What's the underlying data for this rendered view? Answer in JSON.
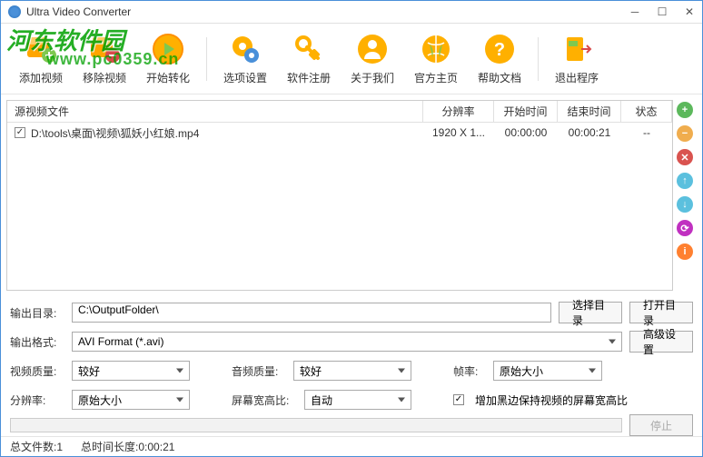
{
  "titlebar": {
    "title": "Ultra Video Converter"
  },
  "watermark": {
    "text": "河东软件园",
    "url": "www.pc0359.cn"
  },
  "toolbar": {
    "add": "添加视频",
    "remove": "移除视频",
    "start": "开始转化",
    "options": "选项设置",
    "register": "软件注册",
    "about": "关于我们",
    "homepage": "官方主页",
    "help": "帮助文档",
    "exit": "退出程序"
  },
  "table": {
    "headers": {
      "file": "源视频文件",
      "res": "分辨率",
      "start": "开始时间",
      "end": "结束时间",
      "status": "状态"
    },
    "rows": [
      {
        "checked": true,
        "file": "D:\\tools\\桌面\\视频\\狐妖小红娘.mp4",
        "res": "1920 X 1...",
        "start": "00:00:00",
        "end": "00:00:21",
        "status": "--"
      }
    ]
  },
  "settings": {
    "outdir_label": "输出目录:",
    "outdir_value": "C:\\OutputFolder\\",
    "browse": "选择目录",
    "open": "打开目录",
    "format_label": "输出格式:",
    "format_value": "AVI Format (*.avi)",
    "advanced": "高级设置",
    "vq_label": "视频质量:",
    "vq_value": "较好",
    "aq_label": "音频质量:",
    "aq_value": "较好",
    "fps_label": "帧率:",
    "fps_value": "原始大小",
    "res_label": "分辨率:",
    "res_value": "原始大小",
    "aspect_label": "屏幕宽高比:",
    "aspect_value": "自动",
    "blackbar_label": "增加黑边保持视频的屏幕宽高比",
    "stop": "停止"
  },
  "statusbar": {
    "filecount_label": "总文件数:",
    "filecount_value": "1",
    "duration_label": "总时间长度:",
    "duration_value": "0:00:21"
  }
}
